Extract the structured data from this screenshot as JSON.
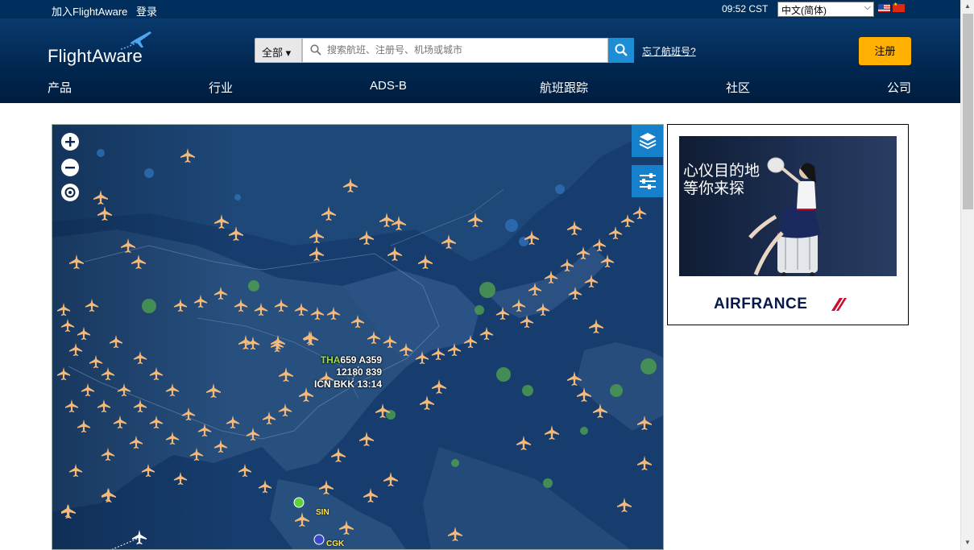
{
  "topbar": {
    "join_label": "加入FlightAware",
    "login_label": "登录",
    "time": "09:52 CST",
    "language": "中文(简体)",
    "flags": [
      "us-flag-icon",
      "cn-flag-icon"
    ]
  },
  "header": {
    "logo_text": "FlightAware",
    "search_scope": "全部 ▾",
    "search_placeholder": "搜索航班、注册号、机场或城市",
    "forgot_label": "忘了航班号?",
    "signup_label": "注册",
    "nav": [
      "产品",
      "行业",
      "ADS-B",
      "航班跟踪",
      "社区",
      "公司"
    ]
  },
  "map": {
    "controls": [
      "zoom-in-icon",
      "zoom-out-icon",
      "locate-icon",
      "layers-icon",
      "filter-icon"
    ],
    "selected_flight": {
      "ident_prefix": "THA",
      "ident_suffix": "659 A359",
      "line2": "12180 839",
      "line3": "ICN BKK 13:14"
    },
    "airports": [
      "SIN",
      "CGK"
    ]
  },
  "ad": {
    "slogan_line1": "心仪目的地",
    "slogan_line2": "等你来探",
    "brand": "AIRFRANCE"
  },
  "colors": {
    "topbar": "#002f5d",
    "signup": "#ffb000",
    "search_button": "#1d8dd6",
    "plane": "#f5b97a",
    "map_water": "#173d6e",
    "map_land": "#294d7a"
  }
}
